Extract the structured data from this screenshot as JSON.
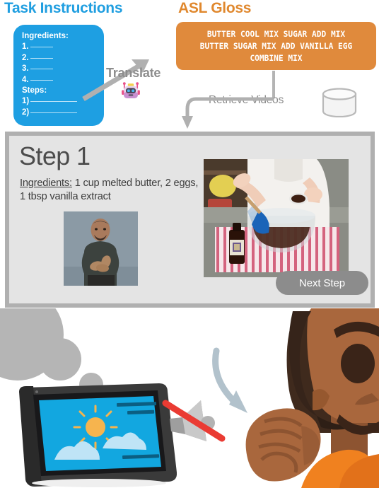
{
  "headings": {
    "task": "Task Instructions",
    "gloss": "ASL Gloss"
  },
  "instruction_card": {
    "ingredients_label": "Ingredients:",
    "ingredient_numbers": [
      "1.",
      "2.",
      "3.",
      "4."
    ],
    "steps_label": "Steps:",
    "step_numbers": [
      "1)",
      "2)"
    ]
  },
  "flow": {
    "translate_label": "Translate",
    "robot_icon": "robot-icon",
    "retrieve_label": "Retrieve Videos",
    "database_icon": "database-cylinder-icon",
    "arrow_translate": "arrow-up-right-icon",
    "arrow_retrieve": "arrow-down-left-icon"
  },
  "gloss_box": {
    "text": "BUTTER COOL MIX SUGAR ADD MIX\nBUTTER SUGAR MIX ADD VANILLA EGG\nCOMBINE MIX"
  },
  "step_card": {
    "title": "Step 1",
    "ingredients_label": "Ingredients:",
    "ingredients_text": " 1 cup melted butter, 2 eggs, 1 tbsp vanilla extract",
    "signer_video_alt": "asl-signer-video",
    "cooking_video_alt": "cooking-demo-video",
    "next_button": "Next Step"
  },
  "bottom_scene": {
    "tablet_alt": "tablet-device",
    "mute_icon": "speaker-muted-icon",
    "person_alt": "deaf-person-emoji",
    "arrow_icon": "curved-arrow-down-icon"
  },
  "colors": {
    "task_heading": "#1f9ee0",
    "gloss_heading": "#e0882e",
    "instruction_card": "#1e9fe2",
    "gloss_box": "#e08a3c",
    "step_card_bg": "#e4e4e4",
    "step_card_border": "#b0b0b0",
    "next_button": "#8c8c8c",
    "arrow_gray": "#b4b4b4",
    "mute_slash": "#ea3b33",
    "shirt_orange": "#f08020",
    "skin": "#a9633b"
  }
}
